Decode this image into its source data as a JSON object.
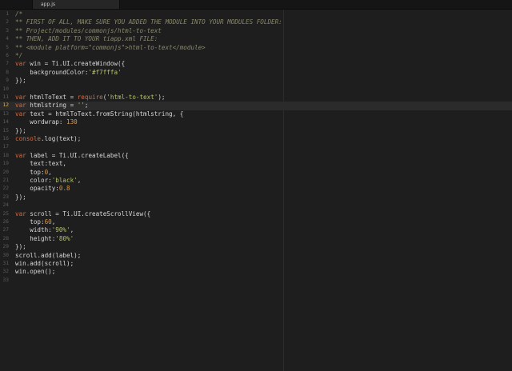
{
  "tab": {
    "title": "app.js"
  },
  "editor": {
    "current_line": 12,
    "lines": [
      {
        "n": "1",
        "t": [
          [
            "comment",
            "/*"
          ]
        ]
      },
      {
        "n": "2",
        "t": [
          [
            "comment",
            "** FIRST OF ALL, MAKE SURE YOU ADDED THE MODULE INTO YOUR MODULES FOLDER:"
          ]
        ]
      },
      {
        "n": "3",
        "t": [
          [
            "comment",
            "** Project/modules/commonjs/html-to-text"
          ]
        ]
      },
      {
        "n": "4",
        "t": [
          [
            "comment",
            "** THEN, ADD IT TO YOUR tiapp.xml FILE:"
          ]
        ]
      },
      {
        "n": "5",
        "t": [
          [
            "comment",
            "** <module platform=\"commonjs\">html-to-text</module>"
          ]
        ]
      },
      {
        "n": "6",
        "t": [
          [
            "comment",
            "*/"
          ]
        ]
      },
      {
        "n": "7",
        "t": [
          [
            "kw",
            "var"
          ],
          [
            "plain",
            " win = Ti.UI.createWindow({"
          ]
        ]
      },
      {
        "n": "8",
        "t": [
          [
            "plain",
            "    backgroundColor:"
          ],
          [
            "str",
            "'#f7fffa'"
          ]
        ]
      },
      {
        "n": "9",
        "t": [
          [
            "plain",
            "});"
          ]
        ]
      },
      {
        "n": "10",
        "t": []
      },
      {
        "n": "11",
        "t": [
          [
            "kw",
            "var"
          ],
          [
            "plain",
            " htmlToText = "
          ],
          [
            "kw",
            "require"
          ],
          [
            "plain",
            "("
          ],
          [
            "str",
            "'html-to-text'"
          ],
          [
            "plain",
            ");"
          ]
        ]
      },
      {
        "n": "12",
        "t": [
          [
            "kw",
            "var"
          ],
          [
            "plain",
            " htmlstring = "
          ],
          [
            "str",
            "''"
          ],
          [
            "plain",
            ";"
          ]
        ]
      },
      {
        "n": "13",
        "t": [
          [
            "kw",
            "var"
          ],
          [
            "plain",
            " text = htmlToText.fromString(htmlstring, {"
          ]
        ]
      },
      {
        "n": "14",
        "t": [
          [
            "plain",
            "    wordwrap: "
          ],
          [
            "num",
            "130"
          ]
        ]
      },
      {
        "n": "15",
        "t": [
          [
            "plain",
            "});"
          ]
        ]
      },
      {
        "n": "16",
        "t": [
          [
            "kw",
            "console"
          ],
          [
            "plain",
            ".log(text);"
          ]
        ]
      },
      {
        "n": "17",
        "t": []
      },
      {
        "n": "18",
        "t": [
          [
            "kw",
            "var"
          ],
          [
            "plain",
            " label = Ti.UI.createLabel({"
          ]
        ]
      },
      {
        "n": "19",
        "t": [
          [
            "plain",
            "    text:text,"
          ]
        ]
      },
      {
        "n": "20",
        "t": [
          [
            "plain",
            "    top:"
          ],
          [
            "num",
            "0"
          ],
          [
            "plain",
            ","
          ]
        ]
      },
      {
        "n": "21",
        "t": [
          [
            "plain",
            "    color:"
          ],
          [
            "str",
            "'black'"
          ],
          [
            "plain",
            ","
          ]
        ]
      },
      {
        "n": "22",
        "t": [
          [
            "plain",
            "    opacity:"
          ],
          [
            "num",
            "0.8"
          ]
        ]
      },
      {
        "n": "23",
        "t": [
          [
            "plain",
            "});"
          ]
        ]
      },
      {
        "n": "24",
        "t": []
      },
      {
        "n": "25",
        "t": [
          [
            "kw",
            "var"
          ],
          [
            "plain",
            " scroll = Ti.UI.createScrollView({"
          ]
        ]
      },
      {
        "n": "26",
        "t": [
          [
            "plain",
            "    top:"
          ],
          [
            "num",
            "60"
          ],
          [
            "plain",
            ","
          ]
        ]
      },
      {
        "n": "27",
        "t": [
          [
            "plain",
            "    width:"
          ],
          [
            "str",
            "'90%'"
          ],
          [
            "plain",
            ","
          ]
        ]
      },
      {
        "n": "28",
        "t": [
          [
            "plain",
            "    height:"
          ],
          [
            "str",
            "'80%'"
          ]
        ]
      },
      {
        "n": "29",
        "t": [
          [
            "plain",
            "});"
          ]
        ]
      },
      {
        "n": "30",
        "t": [
          [
            "plain",
            "scroll.add(label);"
          ]
        ]
      },
      {
        "n": "31",
        "t": [
          [
            "plain",
            "win.add(scroll);"
          ]
        ]
      },
      {
        "n": "32",
        "t": [
          [
            "plain",
            "win.open();"
          ]
        ]
      },
      {
        "n": "33",
        "t": []
      }
    ]
  },
  "colors": {
    "background": "#1e1e1e",
    "comment": "#8a8a6c",
    "keyword": "#d16a43",
    "string": "#b7c26b",
    "number": "#d99a4e",
    "current_line_number": "#e8b34a"
  }
}
